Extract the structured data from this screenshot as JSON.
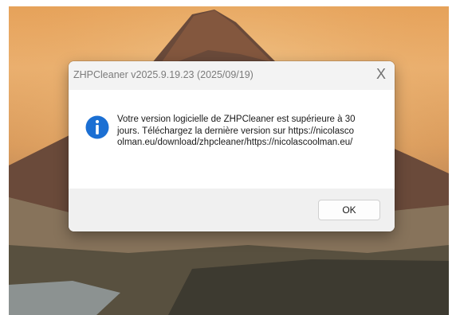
{
  "dialog": {
    "title": "ZHPCleaner v2025.9.19.23 (2025/09/19)",
    "close_glyph": "X",
    "message": "Votre version logicielle de ZHPCleaner est supérieure à 30 jours. Téléchargez la dernière version sur https://nicolascoolman.eu/download/zhpcleaner/https://nicolascoolman.eu/",
    "icon": "info-icon",
    "ok_label": "OK"
  },
  "colors": {
    "accent": "#1b6fd3",
    "titlebar": "#f3f3f3",
    "footer": "#f0f0f0"
  }
}
